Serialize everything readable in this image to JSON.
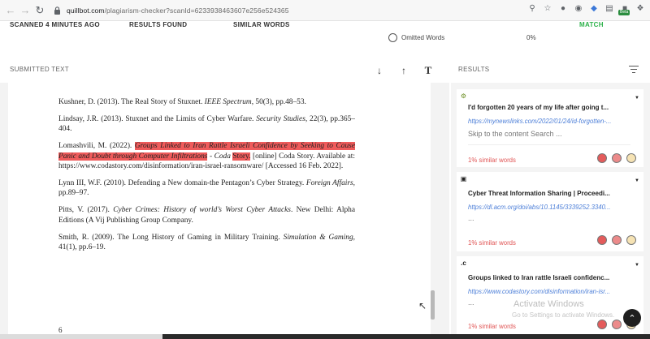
{
  "browser": {
    "url_host": "quillbot.com",
    "url_path": "/plagiarism-checker?scanId=6233938463607e256e524365",
    "extension_badge": "Beta"
  },
  "stats": {
    "scanned": "SCANNED 4 MINUTES AGO",
    "results_found": "RESULTS FOUND",
    "similar_words": "SIMILAR WORDS",
    "match": "MATCH",
    "omitted_label": "Omitted Words",
    "omitted_pct": "0%"
  },
  "submitted": {
    "title": "SUBMITTED TEXT",
    "page_number": "6",
    "references": {
      "r1": {
        "a": "Kushner, D. (2013). The Real Story of Stuxnet. ",
        "i": "IEEE Spectrum",
        "b": ", 50(3), pp.48–53."
      },
      "r2": {
        "a": "Lindsay, J.R. (2013). Stuxnet and the Limits of Cyber Warfare. ",
        "i": "Security Studies",
        "b": ", 22(3), pp.365–404."
      },
      "r3": {
        "a": "Lomashvili, M. (2022). ",
        "hl_italic": "Groups Linked to Iran Rattle Israeli Confidence by Seeking to Cause Panic and Doubt through Computer Infiltrations",
        "mid": " - ",
        "i2": "Coda",
        "hl2": "Story.",
        "b": " [online] Coda Story. Available at: https://www.codastory.com/disinformation/iran-israel-ransomware/ [Accessed 16 Feb. 2022]."
      },
      "r4": {
        "a": "Lynn III, W.F. (2010). Defending a New domain-the Pentagon’s Cyber Strategy. ",
        "i": "Foreign Affairs",
        "b": ", pp.89–97."
      },
      "r5": {
        "a": "Pitts, V. (2017).  ",
        "i": "Cyber Crimes: History of world’s Worst Cyber Attacks",
        "b": ". New Delhi: Alpha Editions (A Vij Publishing Group Company."
      },
      "r6": {
        "a": "Smith, R. (2009). The Long History of Gaming in Military Training. ",
        "i": "Simulation & Gaming",
        "b": ", 41(1), pp.6–19."
      }
    }
  },
  "results": {
    "title": "RESULTS",
    "cards": [
      {
        "title": "I'd forgotten 20 years of my life after going t...",
        "url": "https://mynewslinks.com/2022/01/24/id-forgotten-...",
        "snippet": "Skip to the content Search ...",
        "pct": "1% similar words"
      },
      {
        "title": "Cyber Threat Information Sharing | Proceedi...",
        "url": "https://dl.acm.org/doi/abs/10.1145/3339252.3340...",
        "snippet": "...",
        "pct": "1% similar words"
      },
      {
        "title": "Groups linked to Iran rattle Israeli confidenc...",
        "url": "https://www.codastory.com/disinformation/iran-isr...",
        "snippet": "...",
        "pct": "1% similar words"
      }
    ]
  },
  "watermark": {
    "line1": "Activate Windows",
    "line2": "Go to Settings to activate Windows."
  },
  "colors": {
    "match_green": "#2eb24b",
    "highlight_red": "#ef5b5b",
    "link_blue": "#4d7fd8"
  }
}
